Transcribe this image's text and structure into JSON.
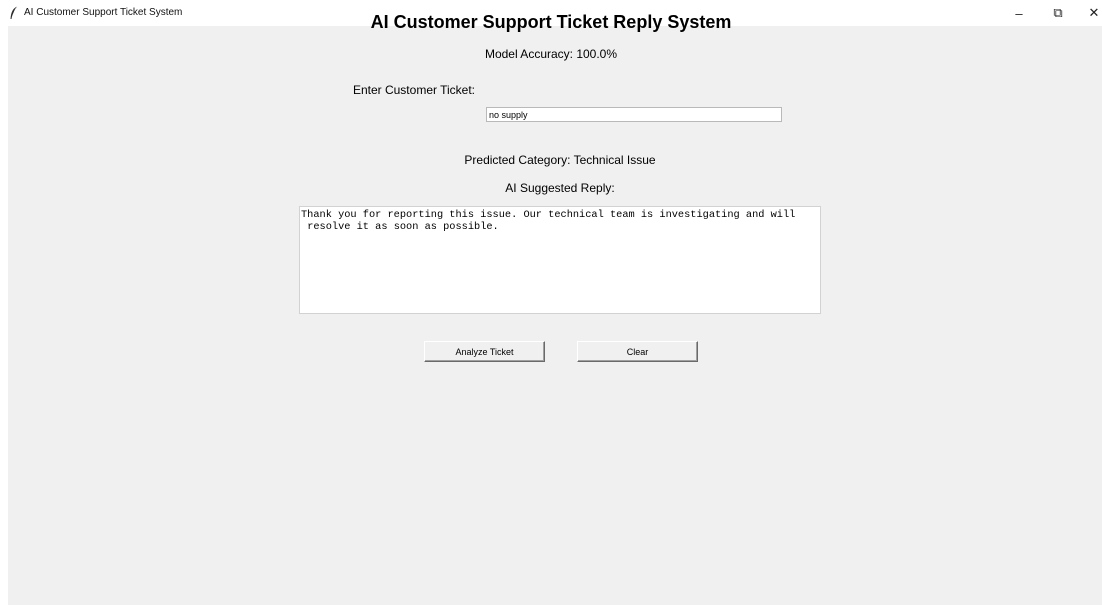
{
  "window": {
    "title": "AI Customer Support Ticket System",
    "icon": "feather-icon",
    "controls": {
      "minimize": "–",
      "maximize": "⧉",
      "close": "✕"
    }
  },
  "main": {
    "heading": "AI Customer Support Ticket Reply System",
    "accuracy": "Model Accuracy: 100.0%",
    "ticket_label": "Enter Customer Ticket:",
    "ticket_value": "no supply",
    "predicted": "Predicted Category: Technical Issue",
    "reply_label": "AI Suggested Reply:",
    "reply_text": "Thank you for reporting this issue. Our technical team is investigating and will\n resolve it as soon as possible."
  },
  "buttons": {
    "analyze": "Analyze Ticket",
    "clear": "Clear"
  }
}
